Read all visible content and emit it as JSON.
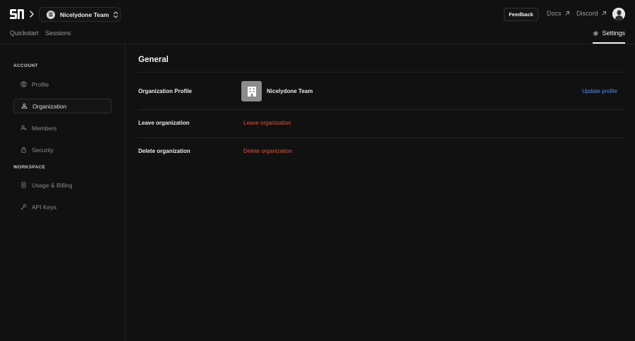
{
  "header": {
    "team_name": "Nicelydone Team",
    "feedback_label": "Feedback",
    "docs_label": "Docs",
    "discord_label": "Discord"
  },
  "tabs": [
    {
      "label": "Quickstart"
    },
    {
      "label": "Sessions"
    },
    {
      "label": "Settings",
      "active": true
    }
  ],
  "sidebar": {
    "account_label": "ACCOUNT",
    "account_items": [
      {
        "label": "Profile",
        "icon": "user-circle-icon"
      },
      {
        "label": "Organization",
        "icon": "organization-icon",
        "active": true
      },
      {
        "label": "Members",
        "icon": "add-member-icon"
      },
      {
        "label": "Security",
        "icon": "lock-icon"
      }
    ],
    "workspace_label": "WORKSPACE",
    "workspace_items": [
      {
        "label": "Usage & Billing",
        "icon": "receipt-icon"
      },
      {
        "label": "API Keys",
        "icon": "key-icon"
      }
    ]
  },
  "main": {
    "title": "General",
    "org_profile_label": "Organization Profile",
    "org_name": "Nicelydone Team",
    "update_profile_label": "Update profile",
    "leave_label": "Leave organization",
    "leave_action": "Leave organization",
    "delete_label": "Delete organization",
    "delete_action": "Delete organization"
  },
  "colors": {
    "background": "#111111",
    "link_blue": "#5b8def",
    "danger_red": "#e0533f",
    "divider": "#242424"
  }
}
